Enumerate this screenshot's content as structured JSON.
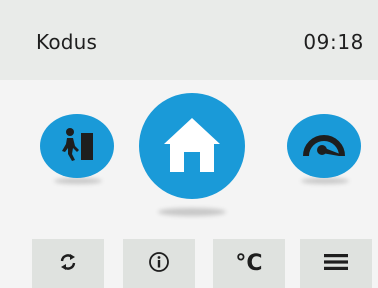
{
  "header": {
    "title": "Kodus",
    "time": "09:18"
  },
  "modes": [
    {
      "name": "away",
      "icon": "person-exit-icon"
    },
    {
      "name": "home",
      "icon": "home-icon",
      "active": true
    },
    {
      "name": "boost",
      "icon": "speedometer-icon"
    }
  ],
  "toolbar": {
    "items": [
      {
        "icon": "sync-arrows-icon"
      },
      {
        "icon": "info-icon"
      },
      {
        "icon": "temperature-celsius-icon",
        "label": "°C"
      },
      {
        "icon": "menu-icon"
      }
    ]
  },
  "colors": {
    "accent": "#1a9ad8",
    "header_bg": "#e9ebe9",
    "tile_bg": "#dfe2df"
  }
}
